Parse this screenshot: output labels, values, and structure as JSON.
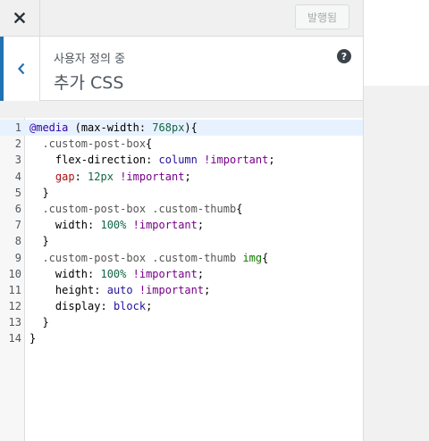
{
  "topbar": {
    "close_icon": "close-icon",
    "publish_label": "발행됨"
  },
  "section": {
    "breadcrumb": "사용자 정의 중",
    "title": "추가 CSS",
    "back_icon": "chevron-left-icon",
    "help_icon": "help-icon",
    "help_glyph": "?"
  },
  "colors": {
    "accent": "#2271b1",
    "panel_bg": "#f0f0f1",
    "active_line": "#e8f2ff"
  },
  "editor": {
    "active_line": 1,
    "lines": [
      {
        "num": "1",
        "tokens": [
          {
            "t": "@media",
            "c": "def"
          },
          {
            "t": " (",
            "c": ""
          },
          {
            "t": "max-width",
            "c": "prop"
          },
          {
            "t": ": ",
            "c": ""
          },
          {
            "t": "768px",
            "c": "num"
          },
          {
            "t": "){",
            "c": ""
          }
        ]
      },
      {
        "num": "2",
        "tokens": [
          {
            "t": "  ",
            "c": ""
          },
          {
            "t": ".custom-post-box",
            "c": "qual"
          },
          {
            "t": "{",
            "c": ""
          }
        ]
      },
      {
        "num": "3",
        "tokens": [
          {
            "t": "    ",
            "c": ""
          },
          {
            "t": "flex-direction",
            "c": "prop"
          },
          {
            "t": ": ",
            "c": ""
          },
          {
            "t": "column",
            "c": "atom"
          },
          {
            "t": " ",
            "c": ""
          },
          {
            "t": "!important",
            "c": "kw"
          },
          {
            "t": ";",
            "c": ""
          }
        ]
      },
      {
        "num": "4",
        "tokens": [
          {
            "t": "    ",
            "c": ""
          },
          {
            "t": "gap",
            "c": "prop-err"
          },
          {
            "t": ": ",
            "c": ""
          },
          {
            "t": "12px",
            "c": "num"
          },
          {
            "t": " ",
            "c": ""
          },
          {
            "t": "!important",
            "c": "kw"
          },
          {
            "t": ";",
            "c": ""
          }
        ]
      },
      {
        "num": "5",
        "tokens": [
          {
            "t": "  }",
            "c": ""
          }
        ]
      },
      {
        "num": "6",
        "tokens": [
          {
            "t": "  ",
            "c": ""
          },
          {
            "t": ".custom-post-box",
            "c": "qual"
          },
          {
            "t": " ",
            "c": ""
          },
          {
            "t": ".custom-thumb",
            "c": "qual"
          },
          {
            "t": "{",
            "c": ""
          }
        ]
      },
      {
        "num": "7",
        "tokens": [
          {
            "t": "    ",
            "c": ""
          },
          {
            "t": "width",
            "c": "prop"
          },
          {
            "t": ": ",
            "c": ""
          },
          {
            "t": "100%",
            "c": "num"
          },
          {
            "t": " ",
            "c": ""
          },
          {
            "t": "!important",
            "c": "kw"
          },
          {
            "t": ";",
            "c": ""
          }
        ]
      },
      {
        "num": "8",
        "tokens": [
          {
            "t": "  }",
            "c": ""
          }
        ]
      },
      {
        "num": "9",
        "tokens": [
          {
            "t": "  ",
            "c": ""
          },
          {
            "t": ".custom-post-box",
            "c": "qual"
          },
          {
            "t": " ",
            "c": ""
          },
          {
            "t": ".custom-thumb",
            "c": "qual"
          },
          {
            "t": " ",
            "c": ""
          },
          {
            "t": "img",
            "c": "tag"
          },
          {
            "t": "{",
            "c": ""
          }
        ]
      },
      {
        "num": "10",
        "tokens": [
          {
            "t": "    ",
            "c": ""
          },
          {
            "t": "width",
            "c": "prop"
          },
          {
            "t": ": ",
            "c": ""
          },
          {
            "t": "100%",
            "c": "num"
          },
          {
            "t": " ",
            "c": ""
          },
          {
            "t": "!important",
            "c": "kw"
          },
          {
            "t": ";",
            "c": ""
          }
        ]
      },
      {
        "num": "11",
        "tokens": [
          {
            "t": "    ",
            "c": ""
          },
          {
            "t": "height",
            "c": "prop"
          },
          {
            "t": ": ",
            "c": ""
          },
          {
            "t": "auto",
            "c": "atom"
          },
          {
            "t": " ",
            "c": ""
          },
          {
            "t": "!important",
            "c": "kw"
          },
          {
            "t": ";",
            "c": ""
          }
        ]
      },
      {
        "num": "12",
        "tokens": [
          {
            "t": "    ",
            "c": ""
          },
          {
            "t": "display",
            "c": "prop"
          },
          {
            "t": ": ",
            "c": ""
          },
          {
            "t": "block",
            "c": "atom"
          },
          {
            "t": ";",
            "c": ""
          }
        ]
      },
      {
        "num": "13",
        "tokens": [
          {
            "t": "  }",
            "c": ""
          }
        ]
      },
      {
        "num": "14",
        "tokens": [
          {
            "t": "}",
            "c": ""
          }
        ]
      }
    ]
  }
}
